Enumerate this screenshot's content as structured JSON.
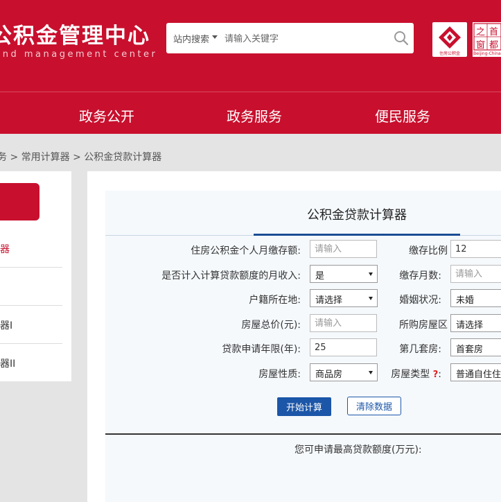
{
  "header": {
    "title": "公积金管理中心",
    "subtitle": "und management center",
    "search": {
      "scope": "站内搜索",
      "placeholder": "请输入关键字"
    },
    "colors": {
      "brand": "#c8102e",
      "primary_button": "#1b56a8"
    }
  },
  "nav": {
    "items": [
      "政务公开",
      "政务服务",
      "便民服务"
    ]
  },
  "breadcrumb": {
    "items": [
      "务",
      "常用计算器",
      "公积金贷款计算器"
    ],
    "separator": ">"
  },
  "sidebar": {
    "items": [
      "器",
      "",
      "器I",
      "器II"
    ]
  },
  "calculator": {
    "title": "公积金贷款计算器",
    "fields": {
      "personal_deposit": {
        "label": "住房公积金个人月缴存额:",
        "placeholder": "请输入"
      },
      "deposit_ratio": {
        "label": "缴存比例",
        "value": "12"
      },
      "include_income": {
        "label": "是否计入计算贷款额度的月收入:",
        "value": "是"
      },
      "deposit_months": {
        "label": "缴存月数:",
        "placeholder": "请输入"
      },
      "hukou": {
        "label": "户籍所在地:",
        "value": "请选择"
      },
      "marital": {
        "label": "婚姻状况:",
        "value": "未婚"
      },
      "house_price": {
        "label": "房屋总价(元):",
        "placeholder": "请输入"
      },
      "district": {
        "label": "所购房屋区",
        "value": "请选择"
      },
      "loan_years": {
        "label": "贷款申请年限(年):",
        "value": "25"
      },
      "nth_house": {
        "label": "第几套房:",
        "value": "首套房"
      },
      "property_nature": {
        "label": "房屋性质:",
        "value": "商品房"
      },
      "house_type": {
        "label": "房屋类型",
        "help": "?",
        "colon": ":",
        "value": "普通自住住"
      }
    },
    "buttons": {
      "calculate": "开始计算",
      "clear": "清除数据"
    },
    "result_label": "您可申请最高贷款额度(万元):"
  }
}
